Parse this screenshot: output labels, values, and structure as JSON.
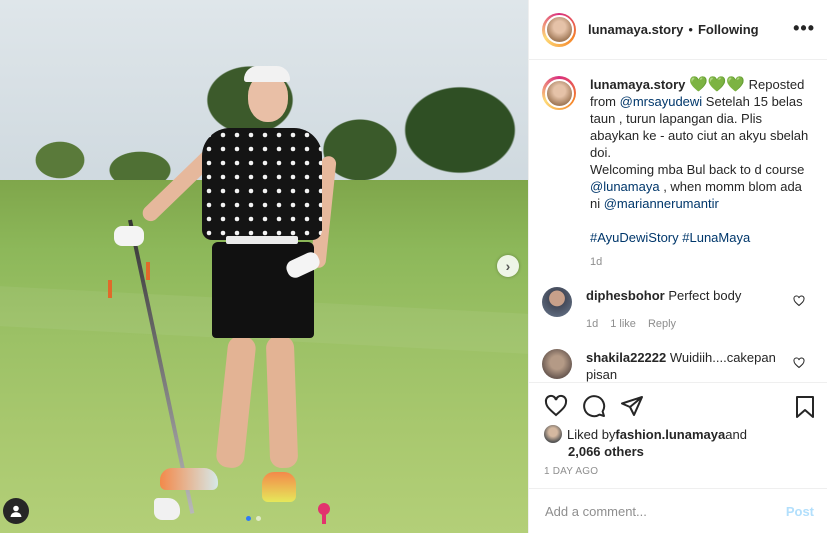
{
  "post": {
    "username": "lunamaya.story",
    "separator": "•",
    "follow_status": "Following",
    "more_label": "•••"
  },
  "caption": {
    "username": "lunamaya.story",
    "hearts": "💚💚💚",
    "text1": " Reposted from ",
    "mention1": "@mrsayudewi",
    "text2": " Setelah 15 belas taun , turun lapangan dia. Plis abaykan ke - auto ciut an akyu sbelah doi.",
    "text3": "Welcoming mba Bul back to d course ",
    "mention2": "@lunamaya",
    "text4": " , when momm blom ada ni ",
    "mention3": "@mariannerumantir",
    "hashtag1": "#AyuDewiStory",
    "hashtag2": "#LunaMaya",
    "age": "1d"
  },
  "comments": [
    {
      "username": "diphesbohor",
      "text": "Perfect body",
      "age": "1d",
      "likes": "1 like",
      "reply": "Reply"
    },
    {
      "username": "shakila22222",
      "text": "Wuidiih....cakepan pisan"
    }
  ],
  "likes": {
    "prefix": "Liked by ",
    "liker": "fashion.lunamaya",
    "and": " and",
    "count": "2,066 others"
  },
  "timestamp": "1 DAY AGO",
  "add_comment": {
    "placeholder": "Add a comment...",
    "post_label": "Post"
  },
  "icons": {
    "like": "heart-icon",
    "comment": "comment-icon",
    "share": "share-icon",
    "save": "bookmark-icon",
    "next": "chevron-right-icon",
    "tag": "user-tag-icon"
  },
  "colors": {
    "link": "#00376b",
    "hearts": "#20b020",
    "post_disabled": "#b2dffc",
    "carousel_active": "#2f7cf6"
  },
  "carousel": {
    "total": 2,
    "active": 1
  }
}
